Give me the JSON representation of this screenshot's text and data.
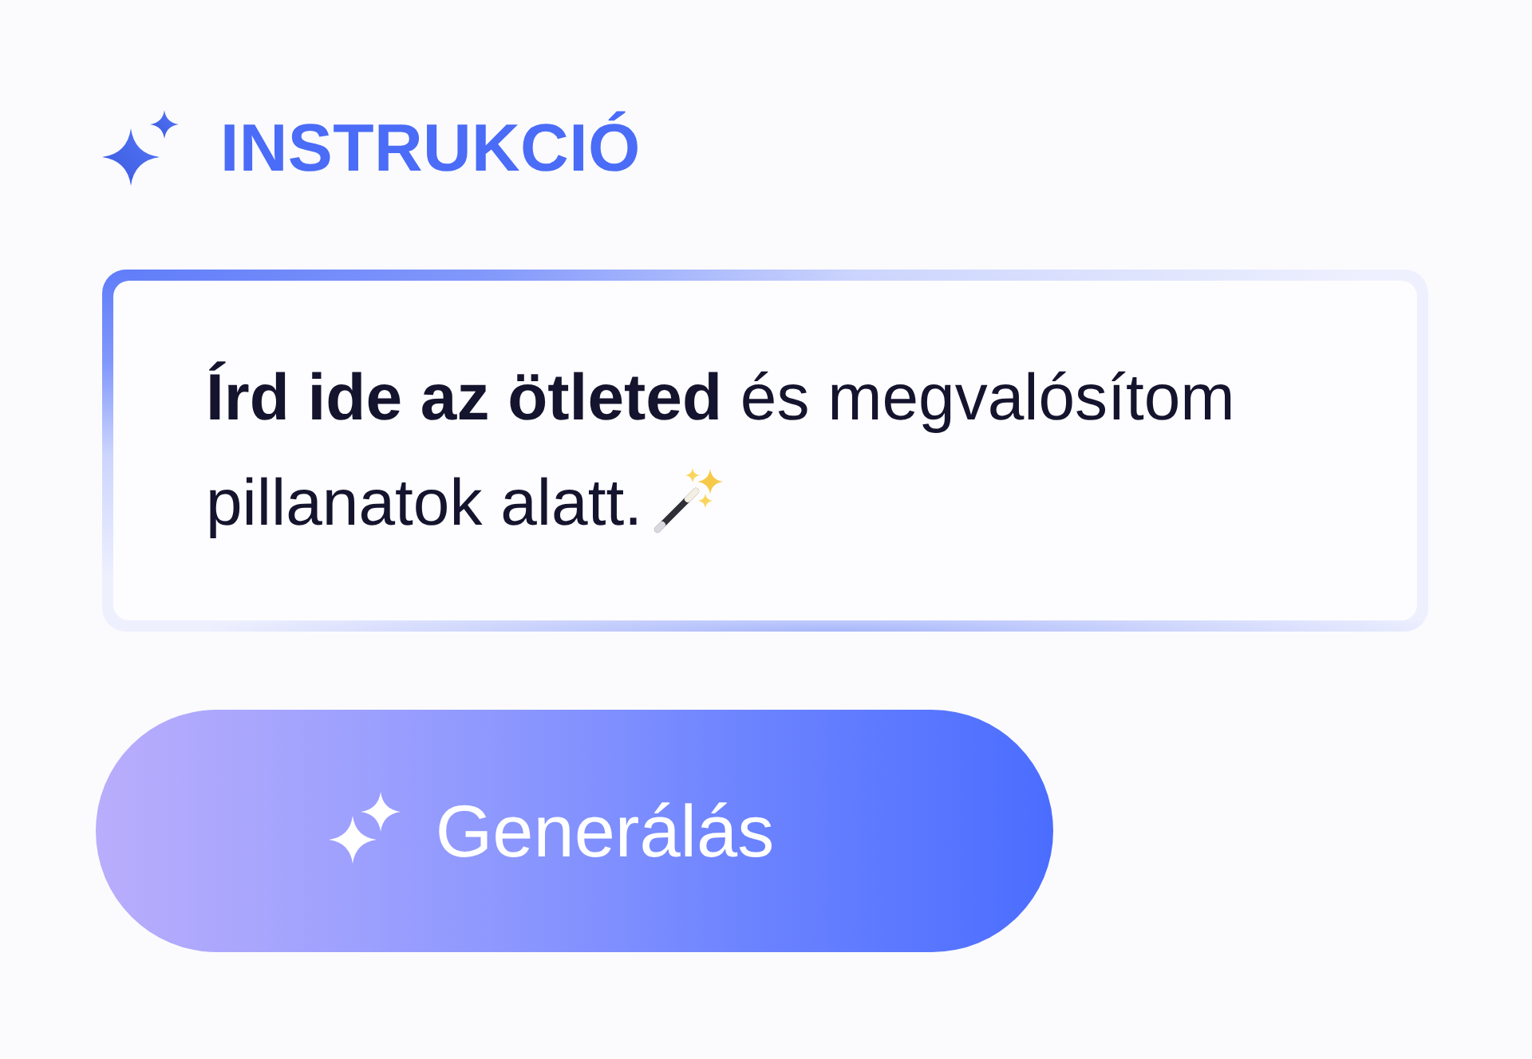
{
  "header": {
    "title": "INSTRUKCIÓ"
  },
  "prompt": {
    "placeholder": "**Írd ide az ötleted** és megvalósítom pillanatok alatt."
  },
  "button": {
    "label": "Generálás"
  }
}
